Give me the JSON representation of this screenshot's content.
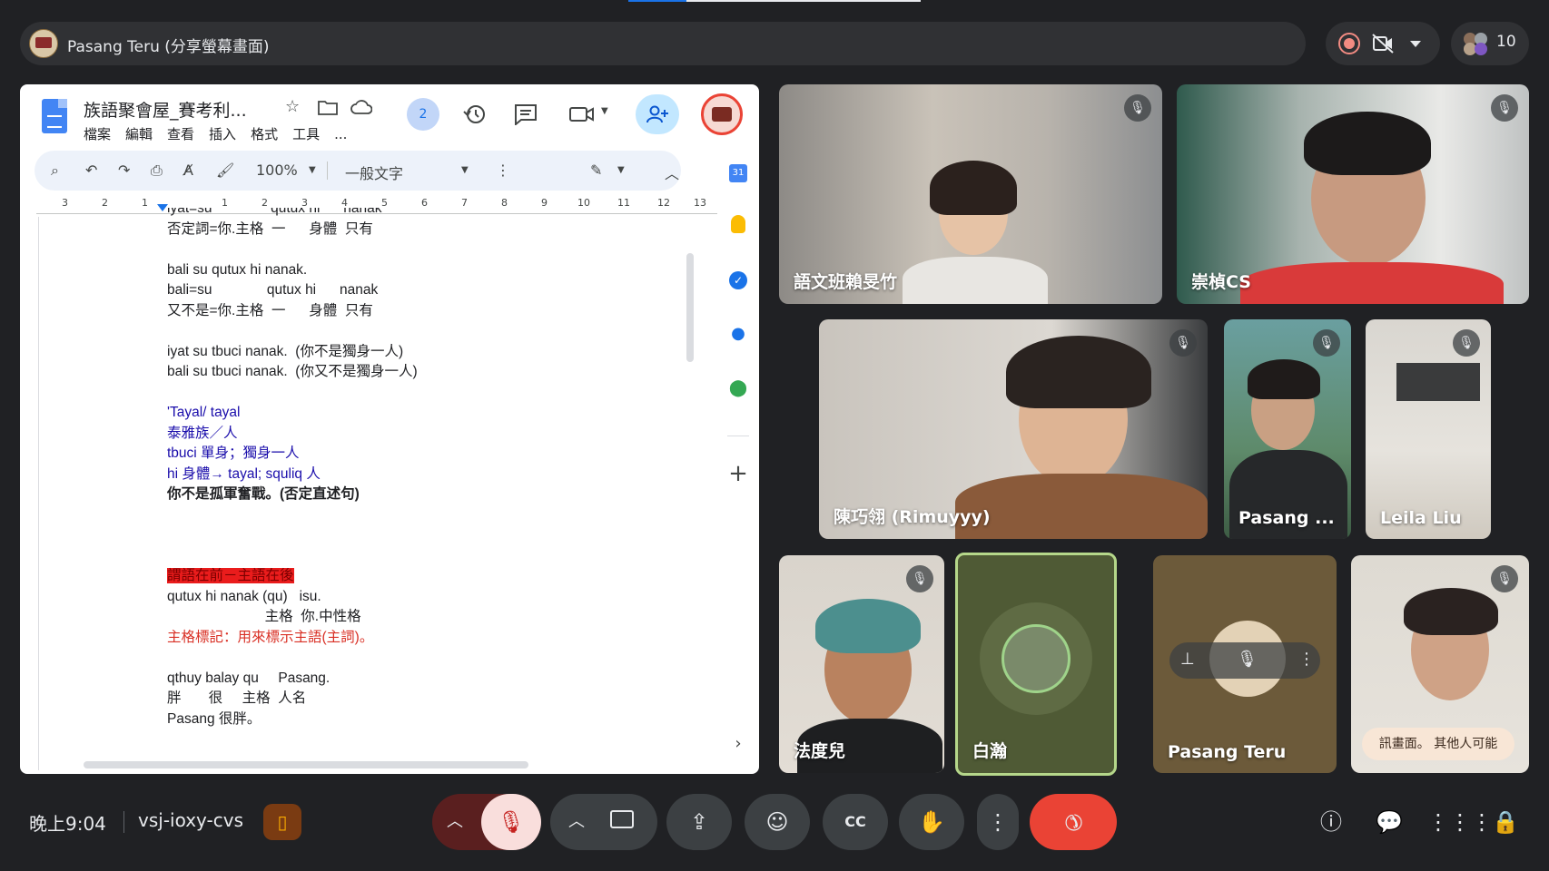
{
  "presenter": {
    "title": "Pasang Teru (分享螢幕畫面)",
    "participant_count": "10"
  },
  "doc": {
    "title": "族語聚會屋_賽考利...",
    "menu": [
      "檔案",
      "編輯",
      "查看",
      "插入",
      "格式",
      "工具",
      "..."
    ],
    "collaborators": "2",
    "toolbar": {
      "zoom": "100%",
      "style": "一般文字"
    },
    "ruler": [
      "3",
      "2",
      "1",
      "1",
      "2",
      "3",
      "4",
      "5",
      "6",
      "7",
      "8",
      "9",
      "10",
      "11",
      "12",
      "13"
    ],
    "lines": [
      "iyat=su               qutux hi      nanak",
      "否定詞=你.主格  一      身體  只有",
      "",
      "bali su qutux hi nanak.",
      "bali=su              qutux hi      nanak",
      "又不是=你.主格  一      身體  只有",
      "",
      "iyat su tbuci nanak.  (你不是獨身一人)",
      "bali su tbuci nanak.  (你又不是獨身一人)",
      "",
      "'Tayal/ tayal",
      "泰雅族／人",
      "tbuci 單身；獨身一人",
      "hi 身體→ tayal; squliq 人",
      "你不是孤軍奮戰。(否定直述句)",
      "",
      "",
      "",
      "謂語在前－主語在後",
      "qutux hi nanak (qu)   isu.",
      "                         主格  你.中性格",
      "主格標記：用來標示主語(主詞)。",
      "",
      "qthuy balay qu     Pasang.",
      "胖       很     主格  人名",
      "Pasang 很胖。"
    ]
  },
  "participants": [
    {
      "name": "語文班賴旻竹"
    },
    {
      "name": "崇楨CS"
    },
    {
      "name": "陳巧翎 (Rimuyyy)"
    },
    {
      "name": "Pasang ..."
    },
    {
      "name": "Leila Liu"
    },
    {
      "name": "法度兒"
    },
    {
      "name": "白瀚"
    },
    {
      "name": "Pasang Teru"
    },
    {
      "name": "",
      "caption": "訊畫面。 其他人可能"
    }
  ],
  "bottom": {
    "time": "晚上9:04",
    "meeting_code": "vsj-ioxy-cvs"
  },
  "icons": [
    "record-icon",
    "camera-off-icon",
    "mic-off-icon",
    "camera-icon",
    "present-icon",
    "emoji-icon",
    "captions-icon",
    "hand-icon",
    "more-icon",
    "end-call-icon",
    "info-icon",
    "chat-icon",
    "apps-icon",
    "host-controls-icon"
  ],
  "colors": {
    "end_call": "#ea4335",
    "mic_off_bg": "#f9dedc",
    "active_speaker_border": "#b5d78a"
  }
}
